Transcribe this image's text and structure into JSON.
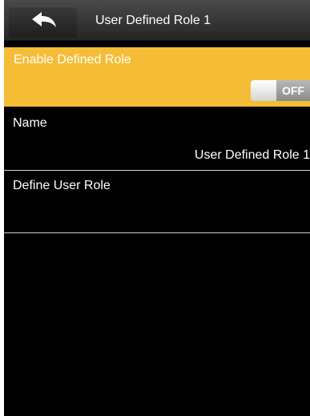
{
  "header": {
    "title": "User Defined Role 1",
    "back_icon": "back-arrow-icon"
  },
  "settings": {
    "enable_defined_role": {
      "label": "Enable Defined Role",
      "toggle_state": "OFF",
      "highlight_color": "#f5bd35"
    },
    "name": {
      "label": "Name",
      "value": "User Defined Role 1"
    },
    "define_user_role": {
      "label": "Define User Role"
    }
  }
}
